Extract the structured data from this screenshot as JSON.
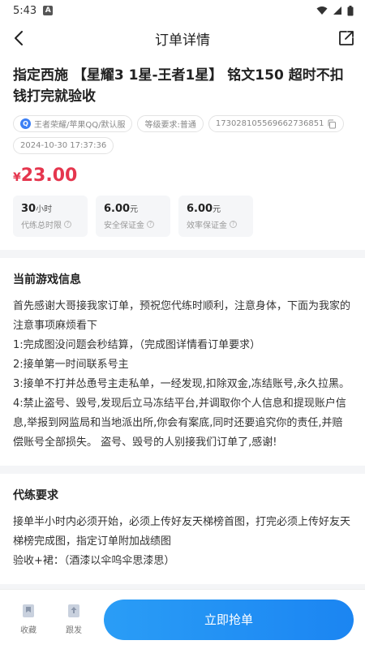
{
  "status_bar": {
    "time": "5:43"
  },
  "nav": {
    "title": "订单详情"
  },
  "order": {
    "title": "指定西施 【星耀3 1星-王者1星】 铭文150 超时不扣钱打完就验收",
    "tags": {
      "server": "王者荣耀/苹果QQ/默认服",
      "level": "等级要求:普通",
      "order_no": "17302810556966273685​1",
      "date": "2024-10-30 17:37:36"
    },
    "price_currency": "¥",
    "price_value": "23.00",
    "guarantees": [
      {
        "value": "30",
        "unit": "小时",
        "label": "代练总时限"
      },
      {
        "value": "6.00",
        "unit": "元",
        "label": "安全保证金"
      },
      {
        "value": "6.00",
        "unit": "元",
        "label": "效率保证金"
      }
    ]
  },
  "game_info": {
    "title": "当前游戏信息",
    "paragraphs": [
      "首先感谢大哥接我家订单，预祝您代练时顺利，注意身体，下面为我家的注意事项麻烦看下",
      "1:完成图没问题会秒结算，（完成图详情看订单要求）",
      "2:接单第一时间联系号主",
      "3:接单不打并怂恿号主走私单，一经发现,扣除双金,冻结账号,永久拉黑。",
      "4:禁止盗号、毁号,发现后立马冻结平台,并调取你个人信息和提现账户信息,举报到网监局和当地派出所,你会有案底,同时还要追究你的责任,并赔偿账号全部损失。 盗号、毁号的人别接我们订单了,感谢!"
    ]
  },
  "requirements": {
    "title": "代练要求",
    "paragraphs": [
      "接单半小时内必须开始，必须上传好友天梯榜首图，打完必须上传好友天梯榜完成图，指定订单附加战绩图",
      "验收+裙：（酒漆以伞呜伞思漆思）"
    ]
  },
  "bottom": {
    "favorite_label": "收藏",
    "post_label": "跟发",
    "grab_label": "立即抢单"
  },
  "colors": {
    "price": "#e5364e",
    "accent": "#1b85f2"
  },
  "icons": [
    "back-icon",
    "share-icon",
    "copy-icon",
    "info-icon",
    "bookmark-icon",
    "upload-icon",
    "wifi-icon",
    "signal-icon",
    "battery-icon"
  ]
}
